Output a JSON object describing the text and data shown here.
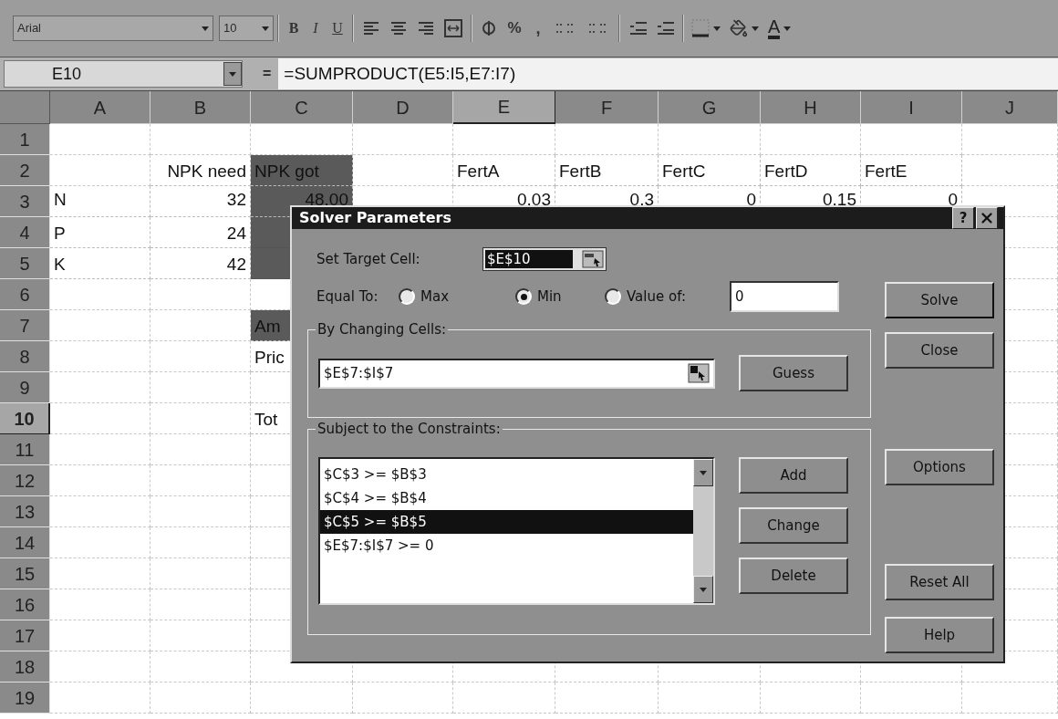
{
  "toolbar": {
    "font": "Arial",
    "size": "10",
    "bold": "B",
    "italic": "I",
    "underline": "U",
    "percent": "%",
    "comma": ",",
    "font_color": "A"
  },
  "formula_bar": {
    "name_box": "E10",
    "equals": "=",
    "formula": "=SUMPRODUCT(E5:I5,E7:I7)"
  },
  "columns": [
    {
      "label": "A",
      "selected": false
    },
    {
      "label": "B",
      "selected": false
    },
    {
      "label": "C",
      "selected": false
    },
    {
      "label": "D",
      "selected": false
    },
    {
      "label": "E",
      "selected": true
    },
    {
      "label": "F",
      "selected": false
    },
    {
      "label": "G",
      "selected": false
    },
    {
      "label": "H",
      "selected": false
    },
    {
      "label": "I",
      "selected": false
    },
    {
      "label": "J",
      "selected": false
    }
  ],
  "rows": [
    {
      "label": "1",
      "selected": false
    },
    {
      "label": "2",
      "selected": false,
      "cells": [
        null,
        {
          "text": "NPK need",
          "kind": "right_aligned",
          "shaded": false
        },
        {
          "text": "NPK got",
          "kind": "left_aligned",
          "shaded": true
        },
        null,
        {
          "text": "FertA",
          "kind": "left_aligned",
          "shaded": false
        },
        {
          "text": "FertB",
          "kind": "left_aligned",
          "shaded": false
        },
        {
          "text": "FertC",
          "kind": "left_aligned",
          "shaded": false
        },
        {
          "text": "FertD",
          "kind": "left_aligned",
          "shaded": false
        },
        {
          "text": "FertE",
          "kind": "left_aligned",
          "shaded": false
        },
        null
      ]
    },
    {
      "label": "3",
      "selected": false,
      "cells": [
        {
          "text": "N",
          "kind": "left_aligned",
          "shaded": false
        },
        {
          "text": "32",
          "kind": "right_aligned",
          "shaded": false
        },
        {
          "text": "48.00",
          "kind": "right_aligned",
          "shaded": true
        },
        null,
        {
          "text": "0.03",
          "kind": "right_aligned",
          "shaded": false
        },
        {
          "text": "0.3",
          "kind": "right_aligned",
          "shaded": false
        },
        {
          "text": "0",
          "kind": "right_aligned",
          "shaded": false
        },
        {
          "text": "0.15",
          "kind": "right_aligned",
          "shaded": false
        },
        {
          "text": "0",
          "kind": "right_aligned",
          "shaded": false
        },
        null
      ]
    },
    {
      "label": "4",
      "selected": false,
      "cells": [
        {
          "text": "P",
          "kind": "left_aligned",
          "shaded": false
        },
        {
          "text": "24",
          "kind": "right_aligned",
          "shaded": false
        },
        {
          "shaded": true
        },
        null,
        null,
        null,
        null,
        null,
        null,
        null
      ]
    },
    {
      "label": "5",
      "selected": false,
      "cells": [
        {
          "text": "K",
          "kind": "left_aligned",
          "shaded": false
        },
        {
          "text": "42",
          "kind": "right_aligned",
          "shaded": false
        },
        {
          "shaded": true
        },
        null,
        null,
        null,
        null,
        null,
        null,
        null
      ]
    },
    {
      "label": "6",
      "selected": false
    },
    {
      "label": "7",
      "selected": false,
      "cells": [
        null,
        null,
        {
          "text": "Am",
          "kind": "left_aligned",
          "shaded": true
        },
        null,
        null,
        null,
        null,
        null,
        null,
        null
      ]
    },
    {
      "label": "8",
      "selected": false,
      "cells": [
        null,
        null,
        {
          "text": "Pric",
          "kind": "left_aligned",
          "shaded": false
        },
        null,
        null,
        null,
        null,
        null,
        null,
        null
      ]
    },
    {
      "label": "9",
      "selected": false
    },
    {
      "label": "10",
      "selected": true,
      "cells": [
        null,
        null,
        {
          "text": "Tot",
          "kind": "left_aligned",
          "shaded": false
        },
        null,
        null,
        null,
        null,
        null,
        null,
        null
      ]
    },
    {
      "label": "11",
      "selected": false
    },
    {
      "label": "12",
      "selected": false
    },
    {
      "label": "13",
      "selected": false
    },
    {
      "label": "14",
      "selected": false
    },
    {
      "label": "15",
      "selected": false
    },
    {
      "label": "16",
      "selected": false
    },
    {
      "label": "17",
      "selected": false
    },
    {
      "label": "18",
      "selected": false
    },
    {
      "label": "19",
      "selected": false
    }
  ],
  "dialog": {
    "title": "Solver Parameters",
    "help": "?",
    "target": {
      "label": "Set Target Cell:",
      "value": "$E$10"
    },
    "equal_to": {
      "label": "Equal To:",
      "options": [
        {
          "label": "Max",
          "selected": false
        },
        {
          "label": "Min",
          "selected": true
        },
        {
          "label": "Value of:",
          "selected": false
        }
      ],
      "value": "0"
    },
    "changing": {
      "legend": "By Changing Cells:",
      "value": "$E$7:$I$7",
      "button": "Guess"
    },
    "constraints": {
      "legend": "Subject to the Constraints:",
      "items": [
        {
          "text": "$C$3 >= $B$3",
          "selected": false
        },
        {
          "text": "$C$4 >= $B$4",
          "selected": false
        },
        {
          "text": "$C$5 >= $B$5",
          "selected": true
        },
        {
          "text": "$E$7:$I$7 >= 0",
          "selected": false
        }
      ],
      "buttons": [
        "Add",
        "Change",
        "Delete"
      ]
    },
    "side_buttons": {
      "top": [
        "Solve",
        "Close"
      ],
      "middle": [
        "Options"
      ],
      "bottom": [
        "Reset All",
        "Help"
      ]
    }
  }
}
